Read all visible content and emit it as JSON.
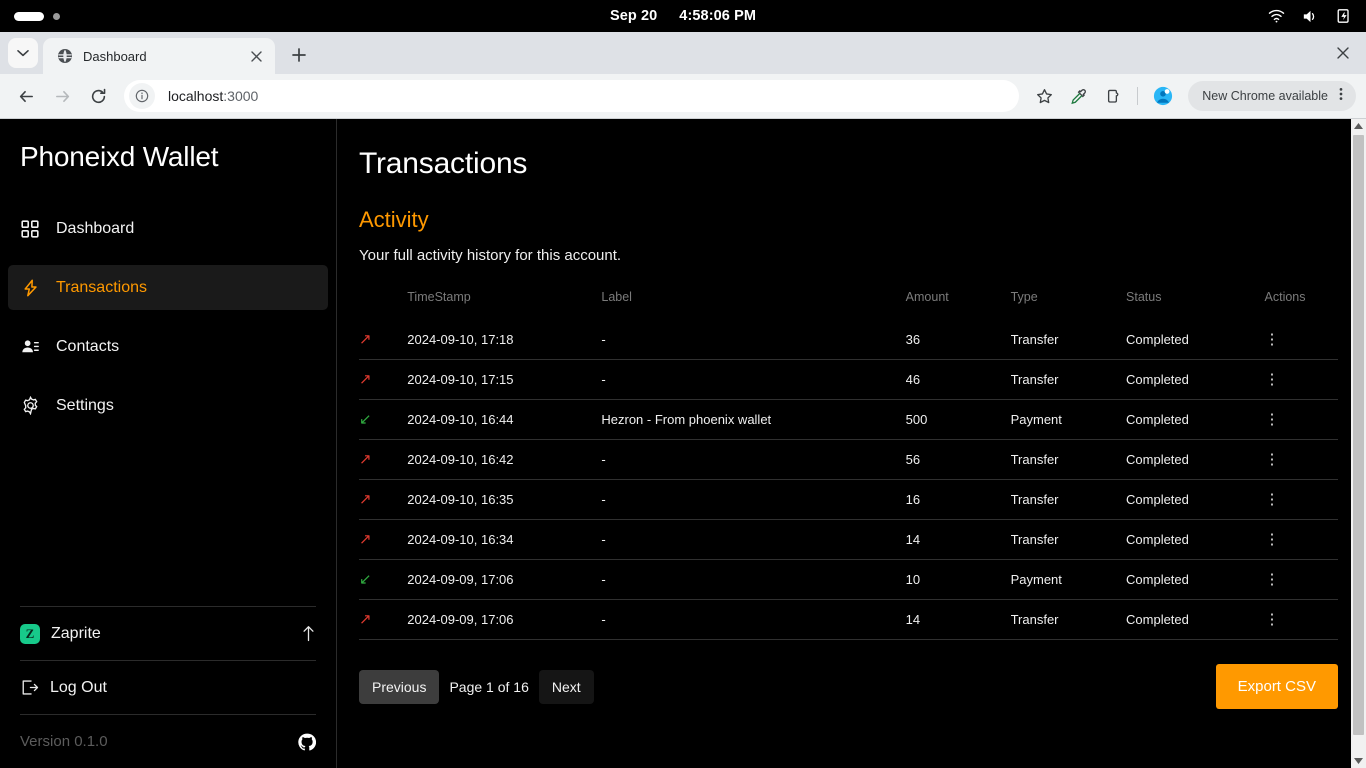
{
  "os_bar": {
    "date": "Sep 20",
    "time": "4:58:06 PM",
    "icons": [
      "wifi-icon",
      "volume-icon",
      "battery-charging-icon"
    ]
  },
  "browser": {
    "tab": {
      "title": "Dashboard",
      "favicon": "globe-icon"
    },
    "new_tab_label": "+",
    "window_close_label": "×",
    "omnibox": {
      "url_host": "localhost",
      "url_port": ":3000",
      "security_icon": "info-circle-icon"
    },
    "toolbar_icons": [
      "bookmark-star-icon",
      "eyedropper-icon",
      "extensions-icon",
      "profile-avatar-icon"
    ],
    "update_pill": {
      "label": "New Chrome available",
      "menu": "⋮"
    }
  },
  "sidebar": {
    "brand": "Phoneixd Wallet",
    "items": [
      {
        "label": "Dashboard",
        "icon": "grid-icon",
        "active": false
      },
      {
        "label": "Transactions",
        "icon": "lightning-bolt-icon",
        "active": true
      },
      {
        "label": "Contacts",
        "icon": "contact-card-icon",
        "active": false
      },
      {
        "label": "Settings",
        "icon": "gear-icon",
        "active": false
      }
    ],
    "zaprite": {
      "label": "Zaprite",
      "badge": "Z",
      "arrow": "arrow-up-icon",
      "color": "#17c98a"
    },
    "logout": {
      "label": "Log Out",
      "icon": "logout-icon"
    },
    "version": {
      "label": "Version 0.1.0",
      "icon": "github-icon"
    }
  },
  "main": {
    "page_title": "Transactions",
    "section_title": "Activity",
    "section_subtitle": "Your full activity history for this account.",
    "table": {
      "columns": [
        "",
        "TimeStamp",
        "Label",
        "Amount",
        "Type",
        "Status",
        "Actions"
      ],
      "rows": [
        {
          "direction": "out",
          "timestamp": "2024-09-10, 17:18",
          "label": "-",
          "amount": "36",
          "type": "Transfer",
          "status": "Completed",
          "actions": "⋮"
        },
        {
          "direction": "out",
          "timestamp": "2024-09-10, 17:15",
          "label": "-",
          "amount": "46",
          "type": "Transfer",
          "status": "Completed",
          "actions": "⋮"
        },
        {
          "direction": "in",
          "timestamp": "2024-09-10, 16:44",
          "label": "Hezron - From phoenix wallet",
          "amount": "500",
          "type": "Payment",
          "status": "Completed",
          "actions": "⋮"
        },
        {
          "direction": "out",
          "timestamp": "2024-09-10, 16:42",
          "label": "-",
          "amount": "56",
          "type": "Transfer",
          "status": "Completed",
          "actions": "⋮"
        },
        {
          "direction": "out",
          "timestamp": "2024-09-10, 16:35",
          "label": "-",
          "amount": "16",
          "type": "Transfer",
          "status": "Completed",
          "actions": "⋮"
        },
        {
          "direction": "out",
          "timestamp": "2024-09-10, 16:34",
          "label": "-",
          "amount": "14",
          "type": "Transfer",
          "status": "Completed",
          "actions": "⋮"
        },
        {
          "direction": "in",
          "timestamp": "2024-09-09, 17:06",
          "label": "-",
          "amount": "10",
          "type": "Payment",
          "status": "Completed",
          "actions": "⋮"
        },
        {
          "direction": "out",
          "timestamp": "2024-09-09, 17:06",
          "label": "-",
          "amount": "14",
          "type": "Transfer",
          "status": "Completed",
          "actions": "⋮"
        }
      ]
    },
    "pagination": {
      "previous_label": "Previous",
      "page_label": "Page 1 of 16",
      "next_label": "Next"
    },
    "export_label": "Export CSV"
  },
  "colors": {
    "accent": "#ff9900",
    "outgoing": "#e03a2f",
    "incoming": "#2faa3f",
    "background": "#000000",
    "zaprite_green": "#17c98a"
  }
}
